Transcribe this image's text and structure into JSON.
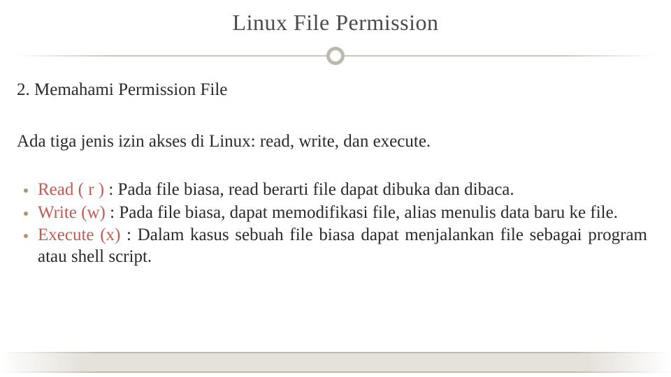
{
  "title": "Linux File Permission",
  "subtitle": "2. Memahami Permission File",
  "intro": "Ada tiga jenis izin akses di Linux: read, write, dan execute.",
  "bullets": [
    {
      "term": "Read ( r )",
      "desc": " : Pada file biasa, read berarti file dapat dibuka dan dibaca."
    },
    {
      "term": "Write (w)",
      "desc": " : Pada file biasa, dapat memodifikasi file, alias menulis data baru ke file."
    },
    {
      "term": "Execute (x)",
      "desc": " : Dalam kasus sebuah file biasa dapat menjalankan file sebagai program atau shell script."
    }
  ]
}
